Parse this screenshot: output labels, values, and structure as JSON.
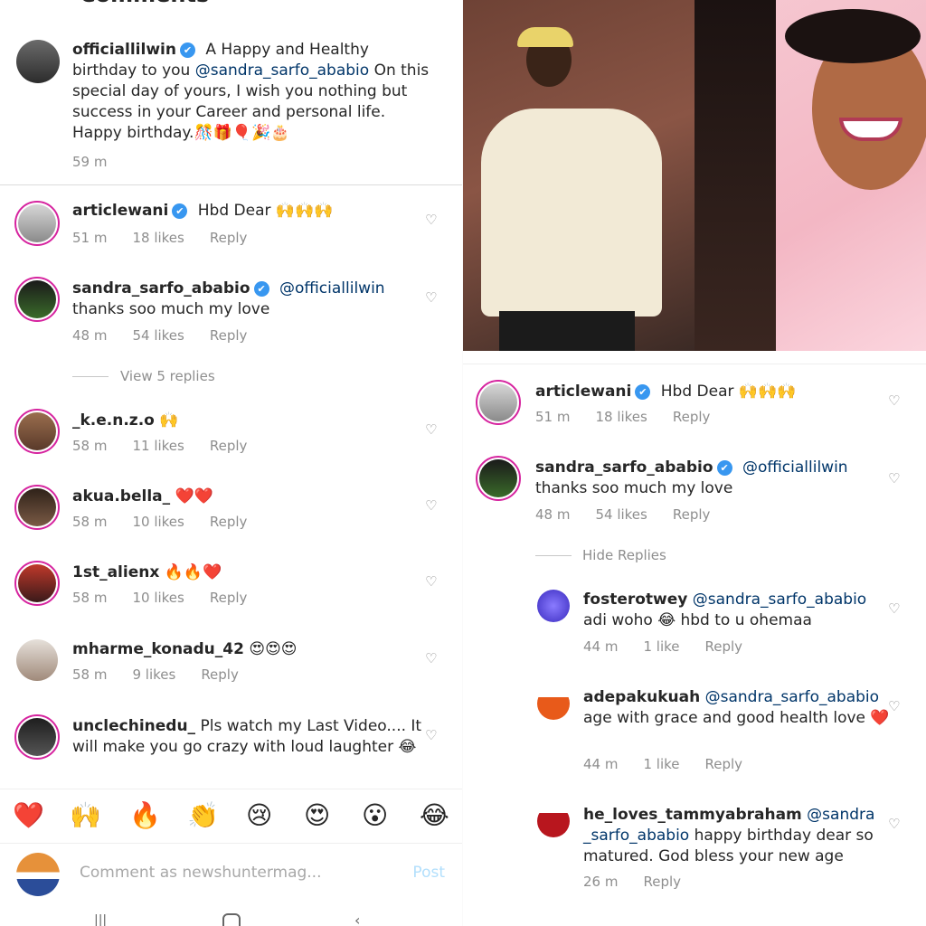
{
  "left": {
    "header": {
      "back_icon": "arrow-left-icon",
      "title": "Comments",
      "dm_icon": "send-icon"
    },
    "caption": {
      "username": "officiallilwin",
      "text_pre": "A Happy and Healthy birthday to you ",
      "mention": "@sandra_sarfo_ababio",
      "text_post": " On this special day of yours, I wish you nothing but success in your Career  and personal life. Happy birthday.🎊🎁🎈🎉🎂",
      "time": "59 m"
    },
    "comments": [
      {
        "username": "articlewani",
        "verified": "✔",
        "text": "Hbd Dear 🙌🙌🙌",
        "time": "51 m",
        "likes": "18 likes",
        "reply": "Reply"
      },
      {
        "username": "sandra_sarfo_ababio",
        "verified": "✔",
        "mention": "@officiallilwin",
        "text": "thanks soo much my love",
        "time": "48 m",
        "likes": "54 likes",
        "reply": "Reply"
      },
      {
        "username": "_k.e.n.z.o",
        "text": "🙌",
        "time": "58 m",
        "likes": "11 likes",
        "reply": "Reply"
      },
      {
        "username": "akua.bella_",
        "text": "❤️❤️",
        "time": "58 m",
        "likes": "10 likes",
        "reply": "Reply"
      },
      {
        "username": "1st_alienx",
        "text": "🔥🔥❤️",
        "time": "58 m",
        "likes": "10 likes",
        "reply": "Reply"
      },
      {
        "username": "mharme_konadu_42",
        "text": "😍😍😍",
        "time": "58 m",
        "likes": "9 likes",
        "reply": "Reply"
      },
      {
        "username": "unclechinedu_",
        "text": "Pls watch my Last Video.... It will make you go crazy with loud laughter 😂"
      }
    ],
    "view_replies": "View 5 replies",
    "emoji_bar": [
      "❤️",
      "🙌",
      "🔥",
      "👏",
      "😢",
      "😍",
      "😮",
      "😂"
    ],
    "composer": {
      "placeholder": "Comment as newshuntermag...",
      "post": "Post"
    }
  },
  "right": {
    "comments": [
      {
        "username": "articlewani",
        "verified": "✔",
        "text": "Hbd Dear 🙌🙌🙌",
        "time": "51 m",
        "likes": "18 likes",
        "reply": "Reply"
      },
      {
        "username": "sandra_sarfo_ababio",
        "verified": "✔",
        "mention": "@officiallilwin",
        "text": "thanks soo much my love",
        "time": "48 m",
        "likes": "54 likes",
        "reply": "Reply"
      }
    ],
    "hide_replies": "Hide Replies",
    "replies": [
      {
        "username": "fosterotwey",
        "mention": "@sandra_sarfo_ababio",
        "text": "adi woho 😂 hbd to u ohemaa",
        "time": "44 m",
        "likes": "1 like",
        "reply": "Reply"
      },
      {
        "username": "adepakukuah",
        "mention": "@sandra_sarfo_ababio",
        "text": "age with grace and good health love ❤️",
        "time": "44 m",
        "likes": "1 like",
        "reply": "Reply"
      },
      {
        "username": "he_loves_tammyabraham",
        "mention": "@sandra _sarfo_ababio",
        "text": "happy birthday dear so matured.  God bless your new age",
        "time": "26 m",
        "reply": "Reply"
      }
    ]
  },
  "icons": {
    "heart": "♡"
  },
  "colors": {
    "verified": "#3897f0",
    "mention": "#003569",
    "meta": "#8e8e8e",
    "story_ring": "#d6249f"
  }
}
